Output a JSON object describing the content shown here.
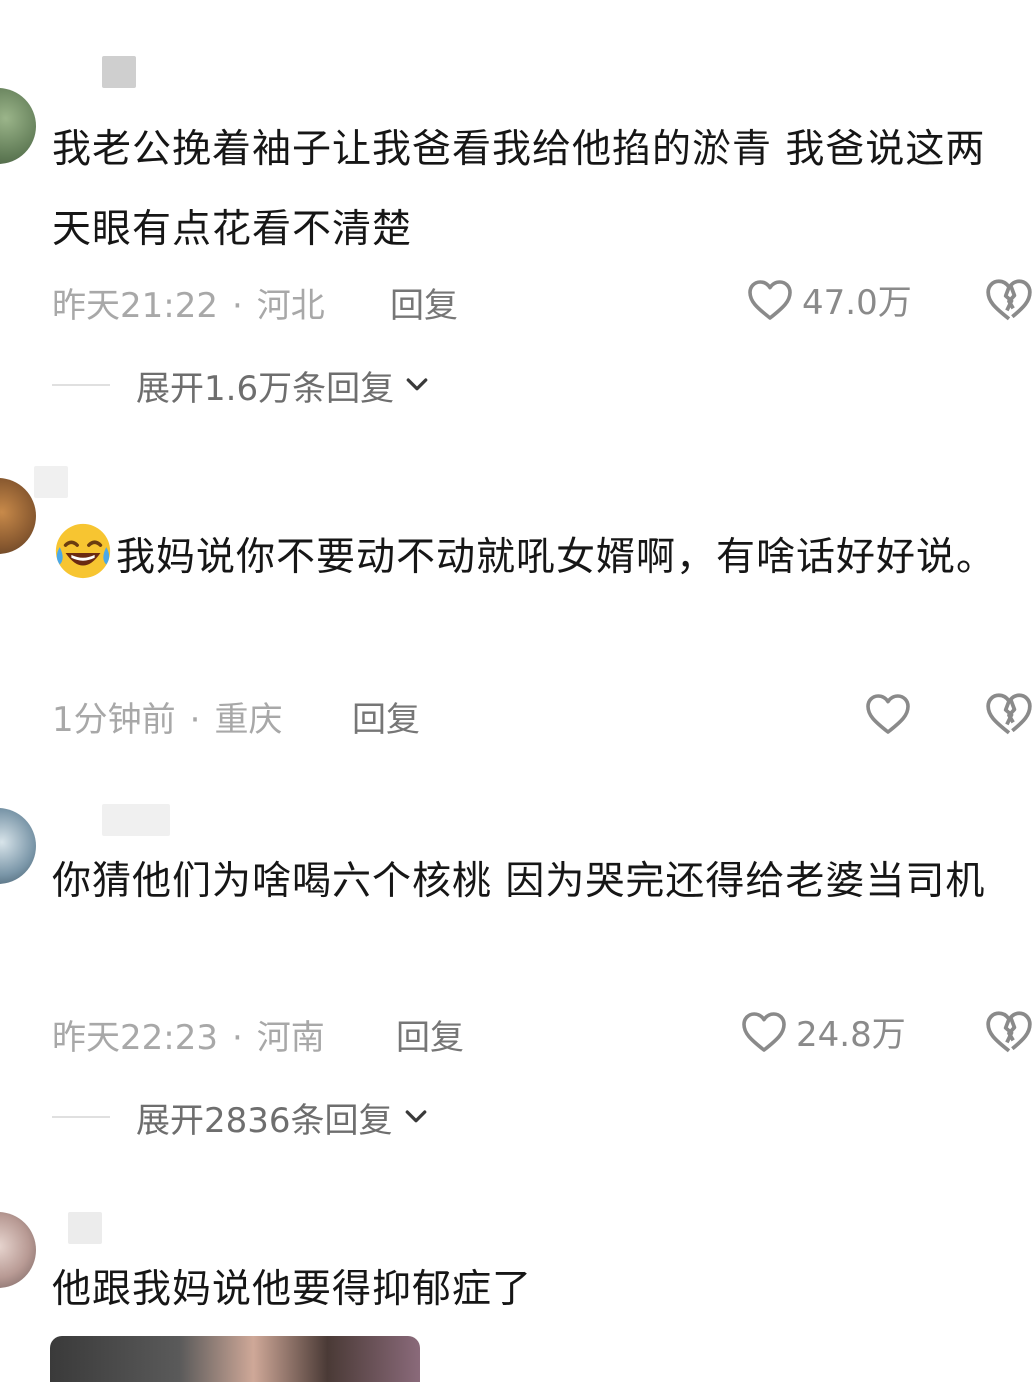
{
  "comments": [
    {
      "text": "我老公挽着袖子让我爸看我给他掐的淤青 我爸说这两天眼有点花看不清楚",
      "time": "昨天21:22",
      "location": "河北",
      "reply_label": "回复",
      "like_count": "47.0万",
      "expand_label": "展开1.6万条回复"
    },
    {
      "text": "我妈说你不要动不动就吼女婿啊，有啥话好好说。",
      "emoji_icon": "laughing-tears-emoji-icon",
      "time": "1分钟前",
      "location": "重庆",
      "reply_label": "回复",
      "like_count": ""
    },
    {
      "text": "你猜他们为啥喝六个核桃  因为哭完还得给老婆当司机",
      "time": "昨天22:23",
      "location": "河南",
      "reply_label": "回复",
      "like_count": "24.8万",
      "expand_label": "展开2836条回复"
    },
    {
      "text": "他跟我妈说他要得抑郁症了"
    }
  ],
  "icons": {
    "like": "heart-outline-icon",
    "dislike": "broken-heart-icon",
    "expand": "chevron-down-icon"
  },
  "colors": {
    "text": "#161616",
    "meta": "#a8a8a8",
    "reply": "#767676",
    "icon": "#8a8a8a"
  }
}
